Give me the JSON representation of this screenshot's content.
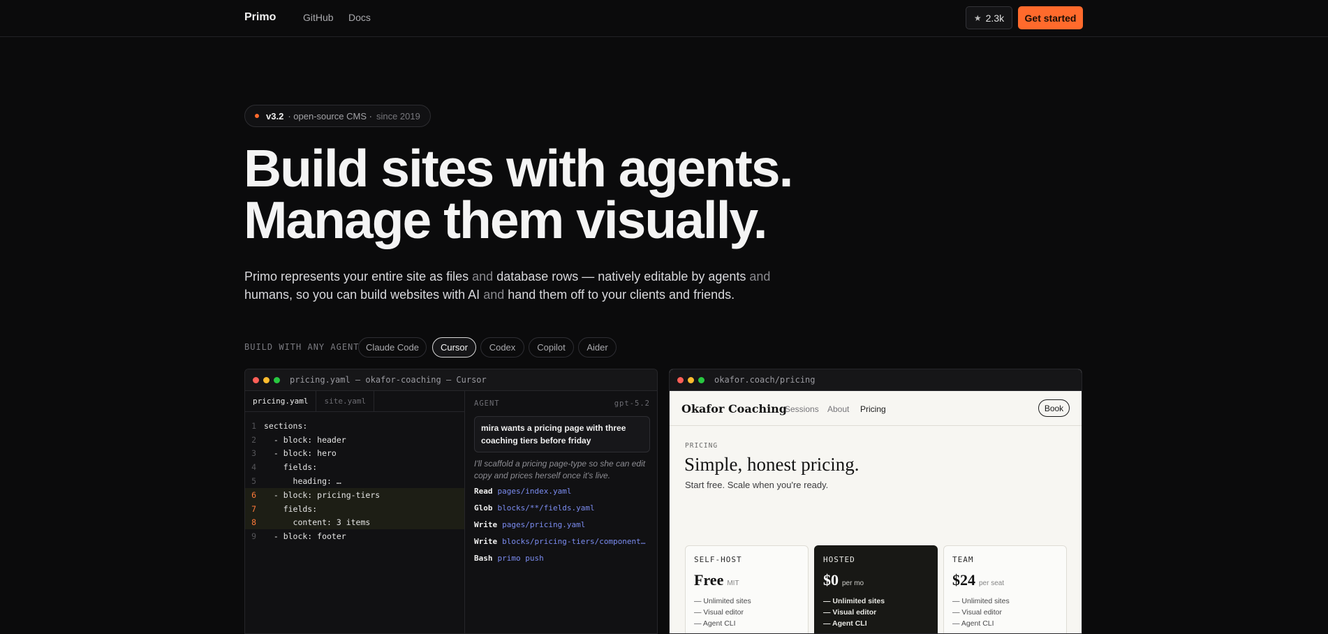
{
  "nav": {
    "brand": "Primo",
    "links": [
      "GitHub",
      "Docs"
    ],
    "stars": "2.3k",
    "cta": "Get started"
  },
  "badge": {
    "version": "v3.2",
    "text": "· open-source CMS ·",
    "since": "since 2019"
  },
  "hero": {
    "line1": "Build sites with agents.",
    "line2": "Manage them visually.",
    "sub_parts": [
      "Primo represents your entire site as files ",
      "and",
      " database rows — natively editable by agents ",
      "and",
      " humans, so you can build websites with AI ",
      "and",
      " hand them off to your clients and friends."
    ]
  },
  "agents": {
    "label": "BUILD WITH ANY AGENT",
    "options": [
      "Claude Code",
      "Cursor",
      "Codex",
      "Copilot",
      "Aider"
    ],
    "selected": "Cursor"
  },
  "editor_window": {
    "title": "pricing.yaml — okafor-coaching — Cursor",
    "tabs": [
      "pricing.yaml",
      "site.yaml"
    ],
    "active_tab": "pricing.yaml",
    "lines": [
      {
        "n": "1",
        "text": "sections:",
        "hl": false
      },
      {
        "n": "2",
        "text": "  - block: header",
        "hl": false
      },
      {
        "n": "3",
        "text": "  - block: hero",
        "hl": false
      },
      {
        "n": "4",
        "text": "    fields:",
        "hl": false
      },
      {
        "n": "5",
        "text": "      heading: …",
        "hl": false
      },
      {
        "n": "6",
        "text": "  - block: pricing-tiers",
        "hl": true
      },
      {
        "n": "7",
        "text": "    fields:",
        "hl": true
      },
      {
        "n": "8",
        "text": "      content: 3 items",
        "hl": true
      },
      {
        "n": "9",
        "text": "  - block: footer",
        "hl": false
      }
    ],
    "agent": {
      "label": "AGENT",
      "model": "gpt-5.2",
      "prompt": "mira wants a pricing page with three coaching tiers before friday",
      "reply": "I'll scaffold a pricing page-type so she can edit copy and prices herself once it's live.",
      "tools": [
        {
          "verb": "Read",
          "arg": "pages/index.yaml"
        },
        {
          "verb": "Glob",
          "arg": "blocks/**/fields.yaml"
        },
        {
          "verb": "Write",
          "arg": "pages/pricing.yaml"
        },
        {
          "verb": "Write",
          "arg": "blocks/pricing-tiers/component.sv…"
        },
        {
          "verb": "Bash",
          "arg": "primo push"
        }
      ]
    }
  },
  "preview_window": {
    "url": "okafor.coach/pricing",
    "site": {
      "logo": "Okafor Coaching",
      "links": [
        "Sessions",
        "About",
        "Pricing"
      ],
      "active_link": "Pricing",
      "book": "Book",
      "eyebrow": "PRICING",
      "heading": "Simple, honest pricing.",
      "subheading": "Start free. Scale when you're ready.",
      "tiers": [
        {
          "name": "SELF-HOST",
          "price": "Free",
          "unit": "MIT",
          "features": [
            "— Unlimited sites",
            "— Visual editor",
            "— Agent CLI"
          ],
          "featured": false
        },
        {
          "name": "HOSTED",
          "price": "$0",
          "unit": "per mo",
          "features": [
            "— Unlimited sites",
            "— Visual editor",
            "— Agent CLI"
          ],
          "featured": true
        },
        {
          "name": "TEAM",
          "price": "$24",
          "unit": "per seat",
          "features": [
            "— Unlimited sites",
            "— Visual editor",
            "— Agent CLI"
          ],
          "featured": false
        }
      ]
    }
  },
  "colors": {
    "accent": "#ff6a2c",
    "background": "#0b0b0c",
    "link_blue": "#7b8cf0"
  }
}
